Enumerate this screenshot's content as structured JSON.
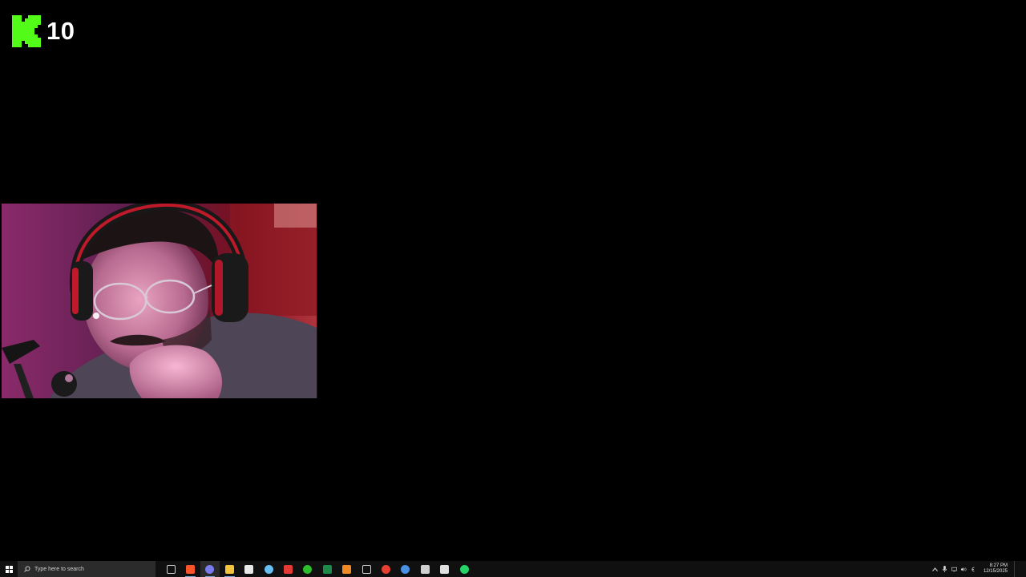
{
  "overlay": {
    "viewer_count": "10",
    "logo_color": "#53fc18"
  },
  "taskbar": {
    "search_placeholder": "Type here to search",
    "apps": [
      {
        "icon": "task-view-icon",
        "color": "#d0d0d0"
      },
      {
        "icon": "brave-browser-icon",
        "color": "#fb542b"
      },
      {
        "icon": "chrome-profile-icon",
        "color": "#7b7bf0"
      },
      {
        "icon": "file-explorer-icon",
        "color": "#f3c33b"
      },
      {
        "icon": "store-icon",
        "color": "#e8e8e8"
      },
      {
        "icon": "steam-icon",
        "color": "#66c0f4"
      },
      {
        "icon": "recorder-icon",
        "color": "#e53935"
      },
      {
        "icon": "xbox-icon",
        "color": "#2dbe2d"
      },
      {
        "icon": "excel-icon",
        "color": "#1d8a4a"
      },
      {
        "icon": "vlc-icon",
        "color": "#f08a24"
      },
      {
        "icon": "window-tiles-icon",
        "color": "#d0d0d0"
      },
      {
        "icon": "chrome-icon",
        "color": "#e44133"
      },
      {
        "icon": "obs-icon",
        "color": "#4a90e2"
      },
      {
        "icon": "generic-app-icon",
        "color": "#d0d0d0"
      },
      {
        "icon": "cloud-app-icon",
        "color": "#e0e0e0"
      },
      {
        "icon": "whatsapp-icon",
        "color": "#25d366"
      }
    ],
    "clock": {
      "time": "8:27 PM",
      "date": "12/15/2025"
    }
  }
}
